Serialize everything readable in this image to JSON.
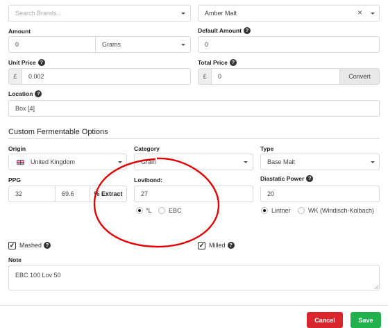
{
  "brand_select": {
    "placeholder": "Search Brands..."
  },
  "product_select": {
    "value": "Amber Malt",
    "clear_icon": "×"
  },
  "amount": {
    "label": "Amount",
    "value": "0",
    "unit": "Grams"
  },
  "default_amount": {
    "label": "Default Amount",
    "value": "0"
  },
  "unit_price": {
    "label": "Unit Price",
    "currency": "£",
    "value": "0.002"
  },
  "total_price": {
    "label": "Total Price",
    "currency": "£",
    "value": "0",
    "convert_label": "Convert"
  },
  "location": {
    "label": "Location",
    "value": "Box [4]"
  },
  "section_title": "Custom Fermentable Options",
  "origin": {
    "label": "Origin",
    "value": "United Kingdom",
    "flag": "uk-flag"
  },
  "category": {
    "label": "Category",
    "value": "Grain"
  },
  "type": {
    "label": "Type",
    "value": "Base Malt"
  },
  "ppg": {
    "label": "PPG",
    "value": "32",
    "extract_value": "69.6",
    "extract_label": "% Extract"
  },
  "lovibond": {
    "label": "Lovibond:",
    "value": "27",
    "unit_options": [
      "°L",
      "EBC"
    ],
    "selected": "°L"
  },
  "diastatic_power": {
    "label": "Diastatic Power",
    "value": "20",
    "unit_options": [
      "Lintner",
      "WK (Windisch-Kolbach)"
    ],
    "selected": "Lintner"
  },
  "mashed": {
    "label": "Mashed",
    "checked": true
  },
  "milled": {
    "label": "Milled",
    "checked": true
  },
  "note": {
    "label": "Note",
    "value": "EBC 100 Lov 50"
  },
  "footer": {
    "cancel_label": "Cancel",
    "save_label": "Save"
  },
  "colors": {
    "cancel": "#d9262c",
    "save": "#22b14c",
    "annotation": "#e00000"
  }
}
